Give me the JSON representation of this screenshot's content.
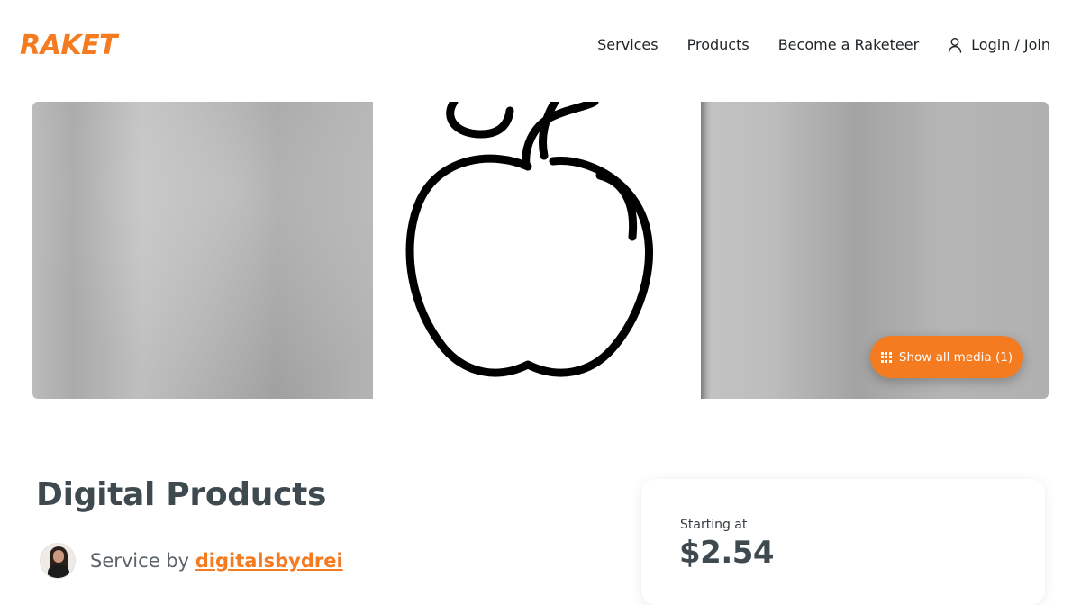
{
  "brand": {
    "logo_text": "RAKET",
    "accent_color": "#f47b20"
  },
  "nav": {
    "services": "Services",
    "products": "Products",
    "become": "Become a Raketeer",
    "login": "Login / Join",
    "login_icon": "user-icon"
  },
  "gallery": {
    "show_media_label": "Show all media (1)",
    "show_media_icon": "grid-icon",
    "center_image": "apple-outline-icon"
  },
  "listing": {
    "title": "Digital Products",
    "service_by_prefix": "Service by",
    "seller_name": "digitalsbydrei"
  },
  "pricing": {
    "label": "Starting at",
    "price": "$2.54"
  }
}
